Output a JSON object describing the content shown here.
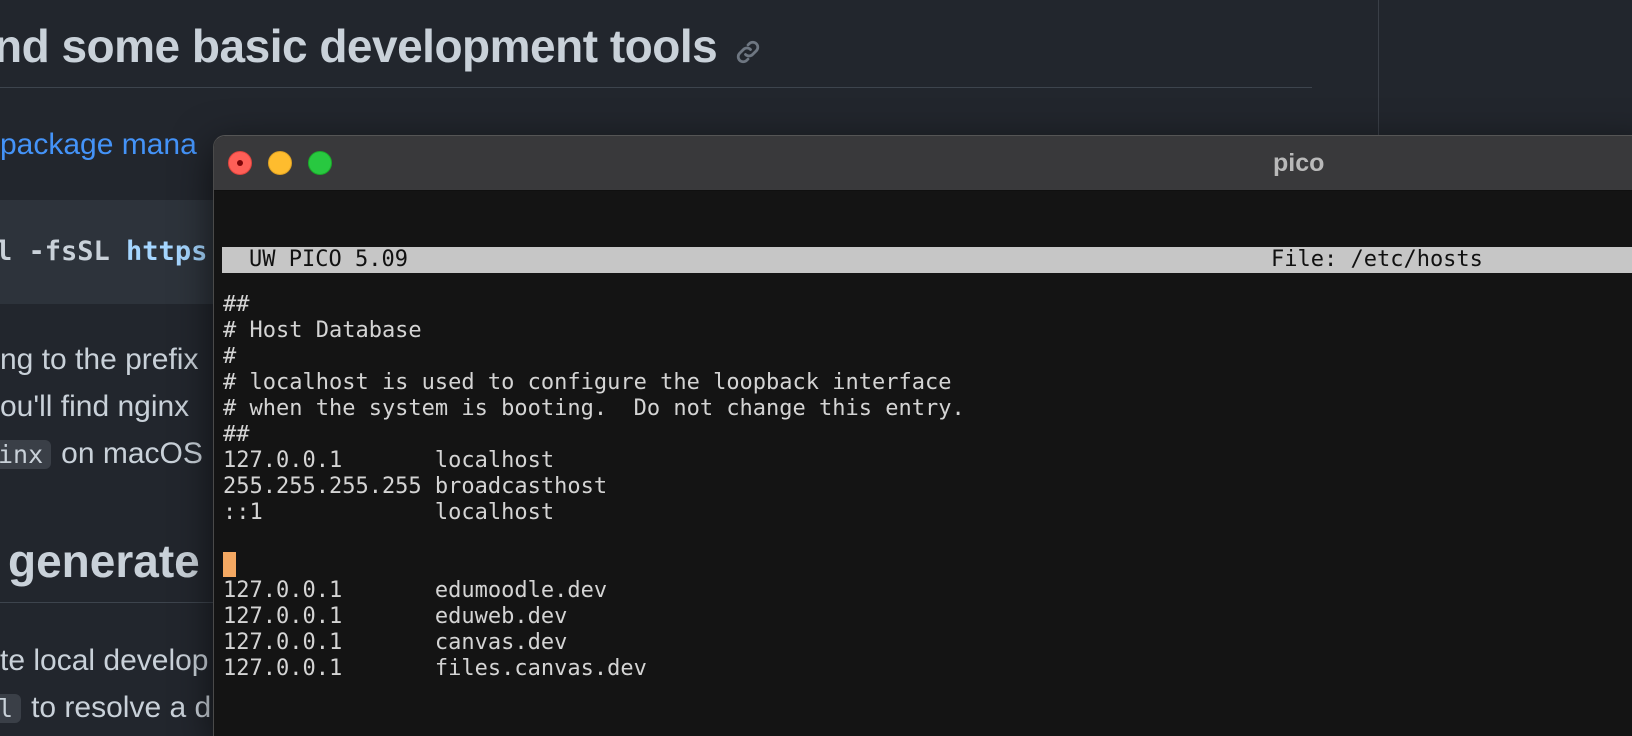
{
  "background_doc": {
    "heading": "nd some basic development tools",
    "link_text": "package mana",
    "code_prefix": "l -fsSL ",
    "code_url": "https",
    "para_line1": "ng to the prefix",
    "para_line2": "ou'll find nginx",
    "para_line3_code": "inx",
    "para_line3_text": "on macOS",
    "heading2": "generate",
    "para_line4": "te local develop",
    "para_line5_code": "l",
    "para_line5_text": "to resolve a d"
  },
  "window": {
    "title": "pico",
    "colors": {
      "close": "#fe5f57",
      "minimize": "#febc2e",
      "zoom": "#28c840",
      "cursor": "#f4a862",
      "header_bar": "#c6c6c6"
    }
  },
  "pico": {
    "version": "UW PICO 5.09",
    "file": "File: /etc/hosts",
    "lines": [
      "##",
      "# Host Database",
      "#",
      "# localhost is used to configure the loopback interface",
      "# when the system is booting.  Do not change this entry.",
      "##",
      "127.0.0.1       localhost",
      "255.255.255.255 broadcasthost",
      "::1             localhost",
      "",
      "",
      "127.0.0.1       edumoodle.dev",
      "127.0.0.1       eduweb.dev",
      "127.0.0.1       canvas.dev",
      "127.0.0.1       files.canvas.dev"
    ]
  }
}
